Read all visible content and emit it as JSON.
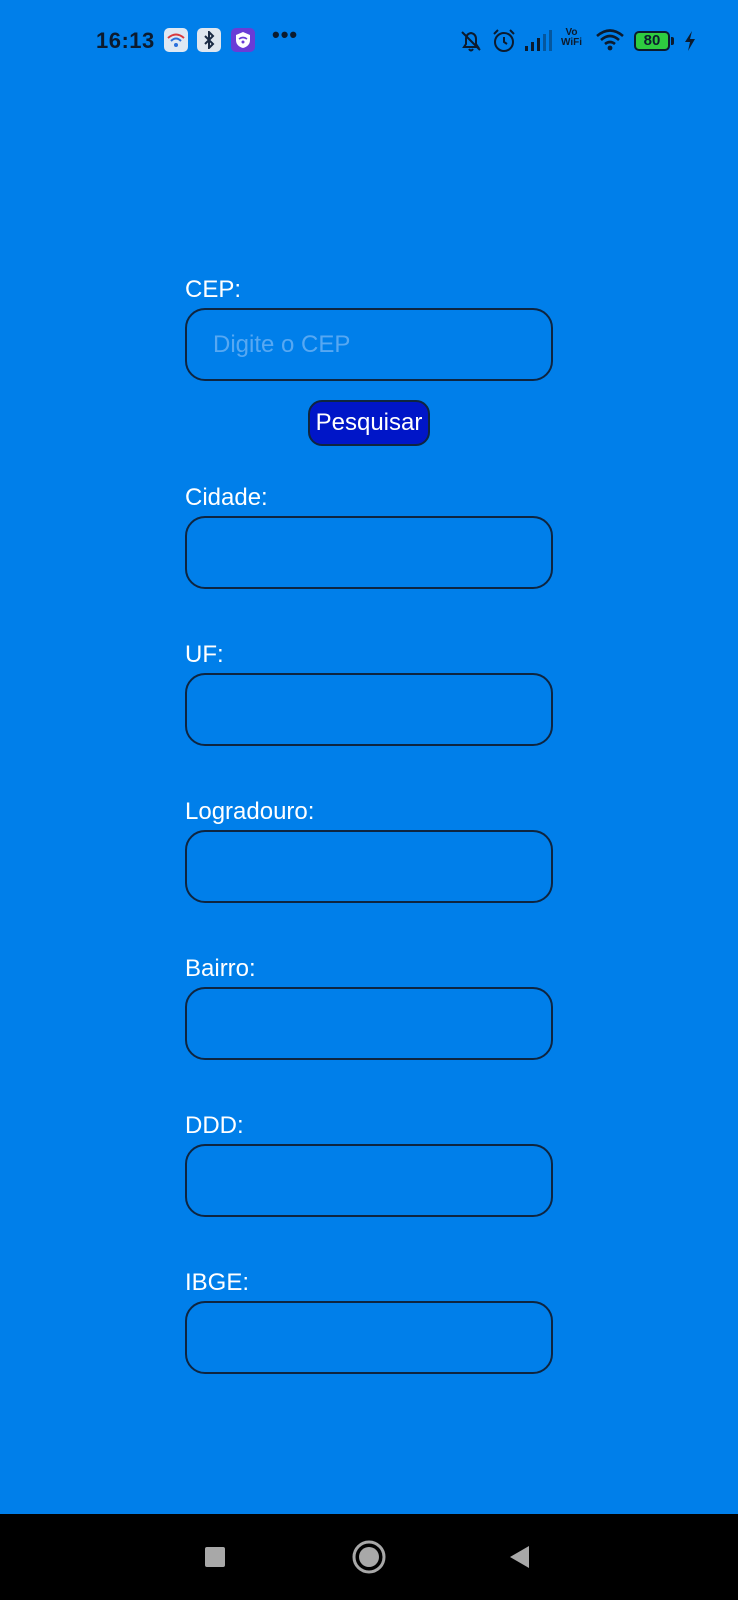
{
  "status_bar": {
    "time": "16:13",
    "notification_icons": [
      "wifi-app-icon",
      "bluetooth-app-icon",
      "vpn-shield-app-icon"
    ],
    "more": "•••",
    "system_icons": [
      "notifications-off-icon",
      "alarm-icon",
      "signal-icon",
      "vowifi-icon",
      "wifi-icon",
      "battery-icon",
      "charging-icon"
    ],
    "vowifi_top": "Vo",
    "vowifi_bottom": "WiFi",
    "battery_level": "80"
  },
  "form": {
    "cep": {
      "label": "CEP:",
      "placeholder": "Digite o CEP",
      "value": ""
    },
    "search_button_label": "Pesquisar",
    "fields": [
      {
        "label": "Cidade:",
        "value": ""
      },
      {
        "label": "UF:",
        "value": ""
      },
      {
        "label": "Logradouro:",
        "value": ""
      },
      {
        "label": "Bairro:",
        "value": ""
      },
      {
        "label": "DDD:",
        "value": ""
      },
      {
        "label": "IBGE:",
        "value": ""
      }
    ]
  },
  "navigation": {
    "buttons": [
      "recent-apps-icon",
      "home-icon",
      "back-icon"
    ]
  },
  "colors": {
    "background": "#007fea",
    "button": "#0016c8",
    "input_border": "#0e2540",
    "placeholder": "#57a8f2",
    "text": "#ffffff",
    "nav_bar": "#000000"
  }
}
